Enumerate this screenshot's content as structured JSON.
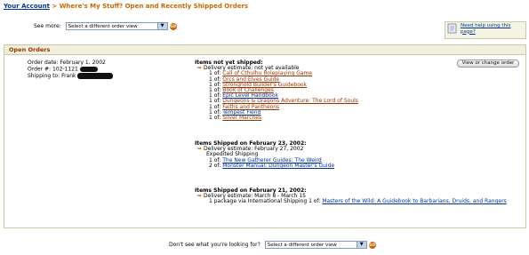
{
  "breadcrumb": {
    "root": "Your Account",
    "separator": " > ",
    "current": "Where's My Stuff? Open and Recently Shipped Orders"
  },
  "see_more": {
    "label": "See more:",
    "select_value": "Select a different order view",
    "go_label": "GO"
  },
  "help": {
    "text": "Need help using this page?"
  },
  "open_orders": {
    "header": "Open Orders",
    "order_date_label": "Order date:",
    "order_date_value": "February 1, 2002",
    "order_num_label": "Order #:",
    "order_num_value": "102-1121",
    "shipping_label": "Shipping to:",
    "shipping_value": "Frank",
    "change_button": "View or change order",
    "not_shipped": {
      "title": "Items not yet shipped:",
      "delivery": "Delivery estimate: not yet available",
      "items": [
        {
          "qty": "1 of:",
          "name": "Call of Cthulhu Roleplaying Game",
          "visited": true
        },
        {
          "qty": "1 of:",
          "name": "Orcs and Elves Guide",
          "visited": true
        },
        {
          "qty": "1 of:",
          "name": "Stronghold Builder's Guidebook",
          "visited": true
        },
        {
          "qty": "1 of:",
          "name": "Book of Challenges",
          "visited": true
        },
        {
          "qty": "1 of:",
          "name": "Epic Level Handbook",
          "visited": false
        },
        {
          "qty": "1 of:",
          "name": "Dungeons & Dragons Adventure: The Lord of Souls",
          "visited": true
        },
        {
          "qty": "1 of:",
          "name": "Faiths and Pantheons",
          "visited": true
        },
        {
          "qty": "1 of:",
          "name": "Tempest Fiend",
          "visited": false
        },
        {
          "qty": "1 of:",
          "name": "Silver Marches",
          "visited": true
        }
      ]
    },
    "shipped1": {
      "title": "Items Shipped on February 23, 2002:",
      "delivery": "Delivery estimate: February 27, 2002",
      "method": "Expedited Shipping",
      "items": [
        {
          "qty": "1 of:",
          "name": "The New Gatherer Guides: The Weird",
          "visited": false
        },
        {
          "qty": "2 of:",
          "name": "Monster Manual: Dungeon Master's Guide",
          "visited": false
        }
      ]
    },
    "shipped2": {
      "title": "Items Shipped on February 21, 2002:",
      "delivery": "Delivery estimate: March 8 - March 15",
      "method": "1 package via International Shipping",
      "items": [
        {
          "qty": "1 of:",
          "name": "Masters of the Wild: A Guidebook to Barbarians, Druids, and Rangers",
          "visited": false
        }
      ]
    }
  },
  "footer": {
    "label": "Don't see what you're looking for?",
    "select_value": "Select a different order view",
    "go_label": "GO"
  },
  "colors": {
    "link": "#003399",
    "visited": "#993300",
    "accent": "#cc6600",
    "panel_header_bg": "#efefdc",
    "panel_border": "#c9c9a3"
  }
}
